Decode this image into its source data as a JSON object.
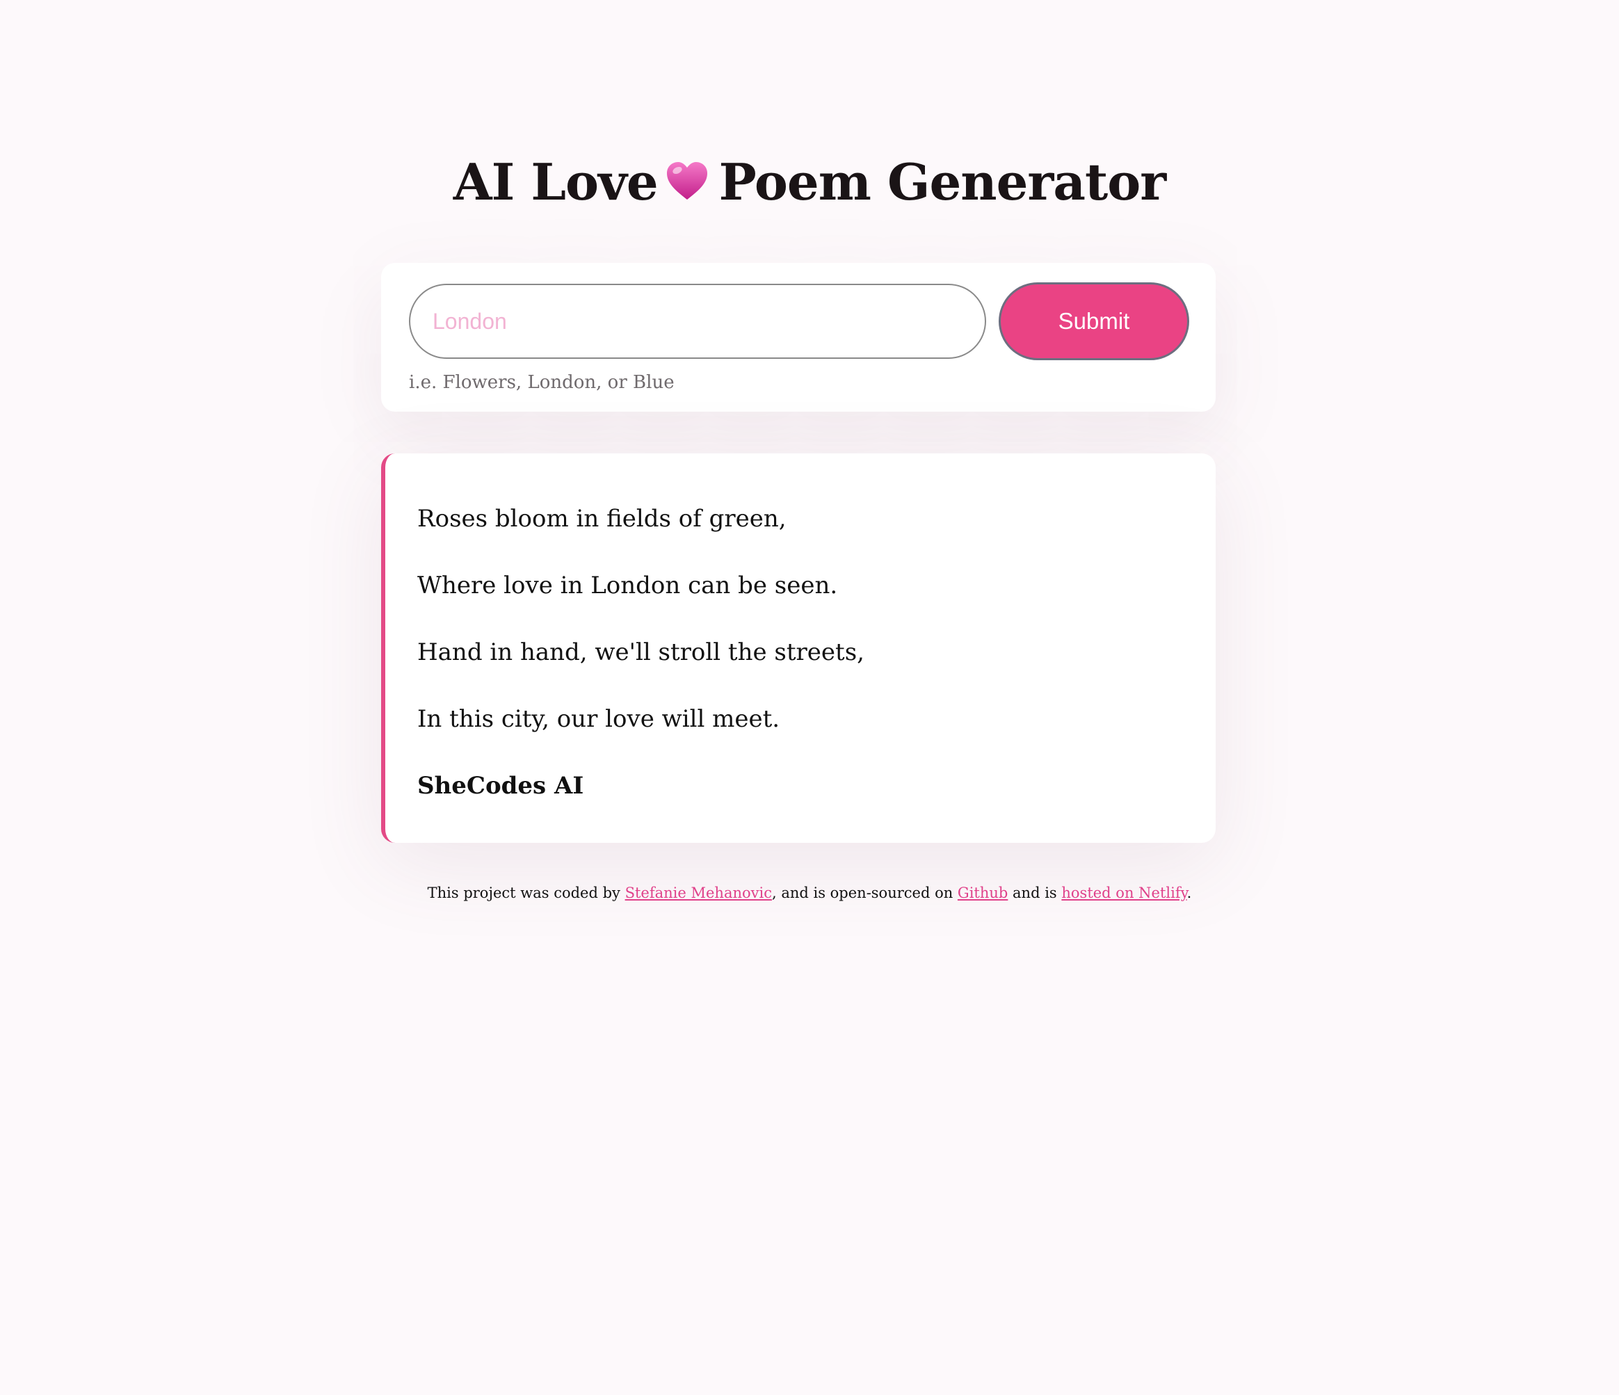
{
  "header": {
    "title_before": "AI Love",
    "title_after": "Poem Generator",
    "heart_icon": "pink-heart-icon"
  },
  "form": {
    "input_placeholder": "London",
    "input_value": "",
    "hint": "i.e. Flowers, London, or Blue",
    "submit_label": "Submit"
  },
  "poem": {
    "lines": [
      "Roses bloom in fields of green,",
      "Where love in London can be seen.",
      "Hand in hand, we'll stroll the streets,",
      "In this city, our love will meet."
    ],
    "author": "SheCodes AI"
  },
  "footer": {
    "text_1": "This project was coded by ",
    "author_link": "Stefanie Mehanovic",
    "text_2": ", and is open-sourced on ",
    "github_link": "Github",
    "text_3": " and is ",
    "netlify_link": "hosted on Netlify",
    "text_4": "."
  },
  "colors": {
    "accent": "#ea4384",
    "background": "#fdf9fb",
    "placeholder": "#f2b3d3",
    "link": "#e0418a"
  }
}
